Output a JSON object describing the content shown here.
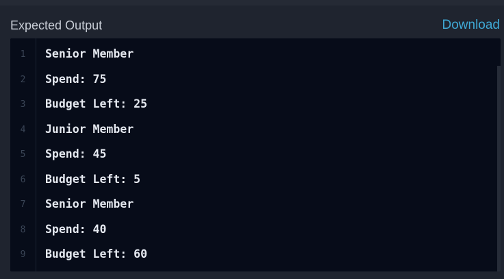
{
  "header": {
    "title": "Expected Output",
    "download_label": "Download"
  },
  "output": {
    "lines": [
      {
        "number": "1",
        "text": "Senior Member"
      },
      {
        "number": "2",
        "text": "Spend: 75"
      },
      {
        "number": "3",
        "text": "Budget Left: 25"
      },
      {
        "number": "4",
        "text": "Junior Member"
      },
      {
        "number": "5",
        "text": "Spend: 45"
      },
      {
        "number": "6",
        "text": "Budget Left: 5"
      },
      {
        "number": "7",
        "text": "Senior Member"
      },
      {
        "number": "8",
        "text": "Spend: 40"
      },
      {
        "number": "9",
        "text": "Budget Left: 60"
      }
    ]
  },
  "colors": {
    "background": "#1f242f",
    "panel": "#070c19",
    "accent": "#3fa9d6",
    "text": "#e5e9f0",
    "line_number": "#3a4556"
  }
}
